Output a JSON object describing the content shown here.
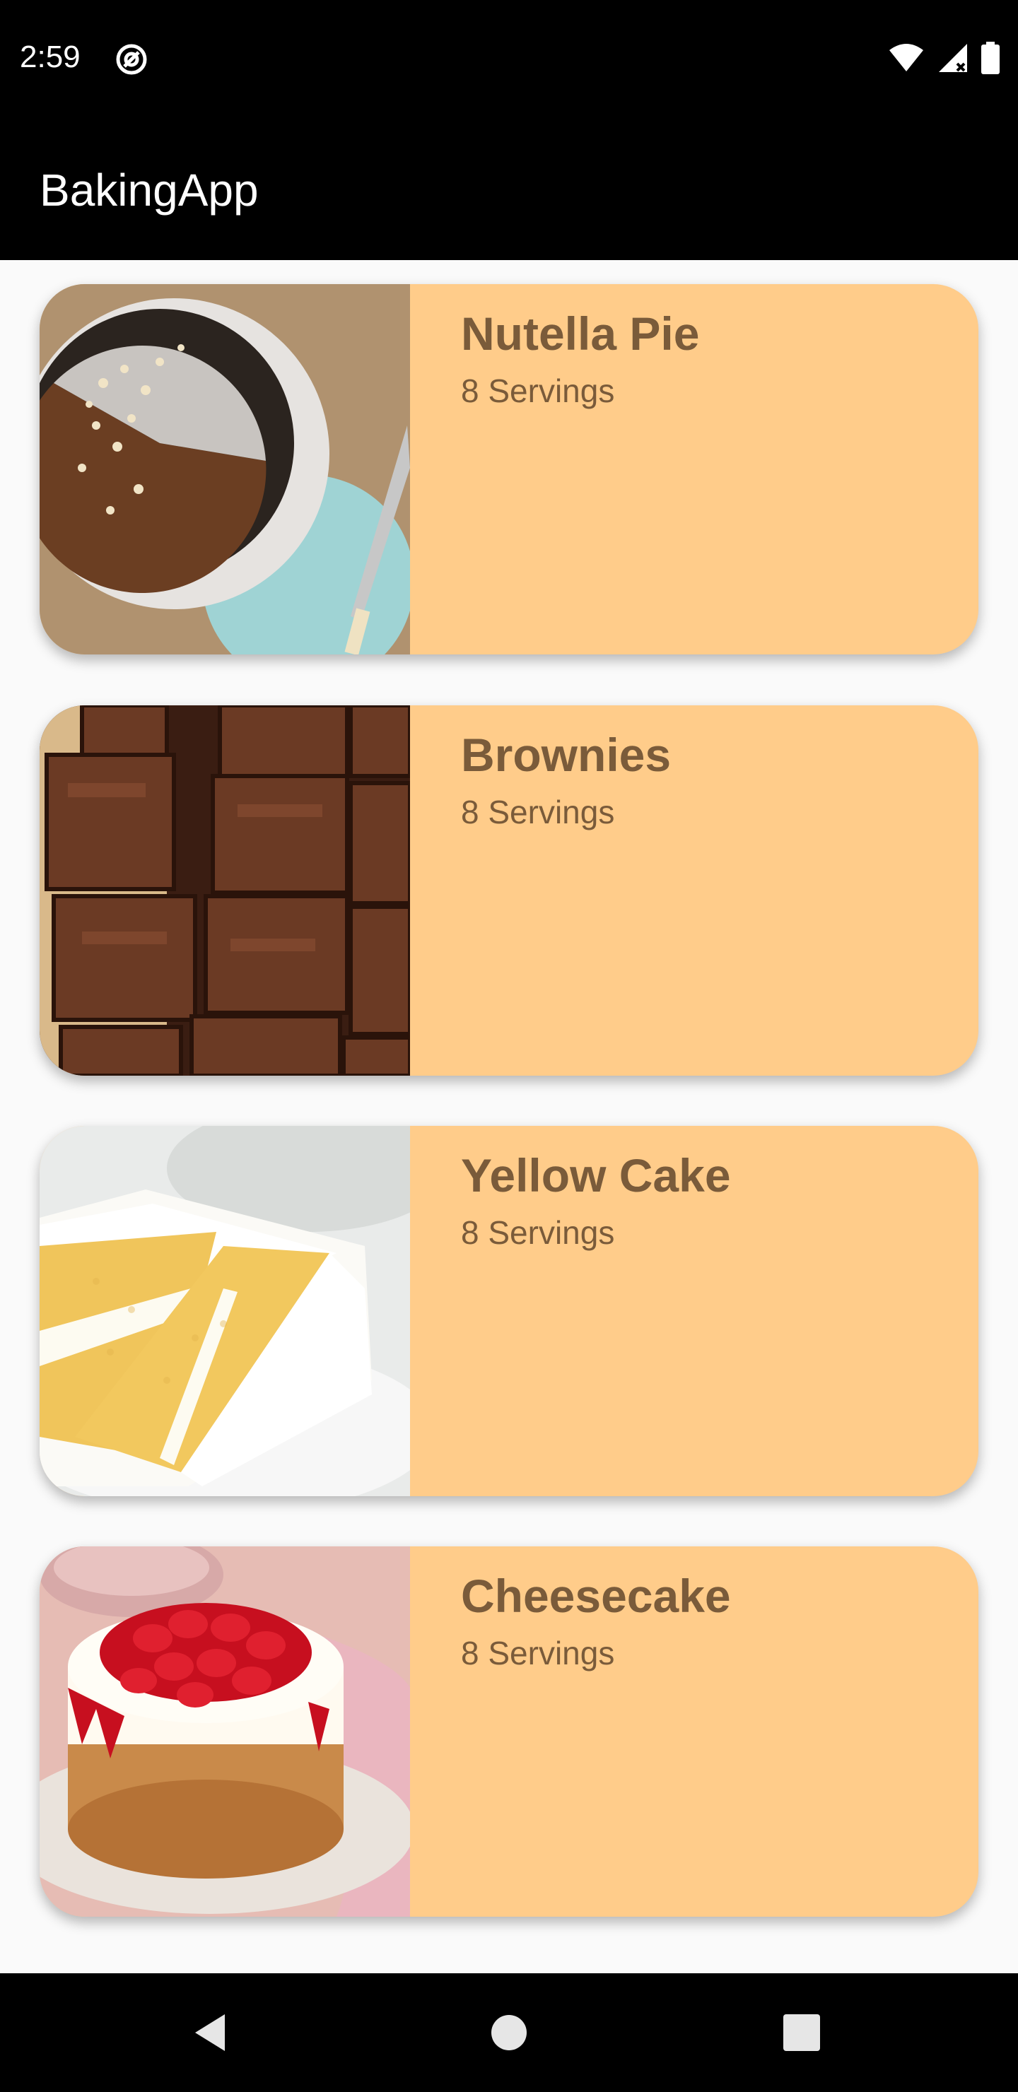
{
  "status_bar": {
    "time": "2:59",
    "icons": [
      "notification-at-icon",
      "wifi-icon",
      "signal-icon",
      "battery-icon"
    ]
  },
  "app_bar": {
    "title": "BakingApp"
  },
  "recipes": [
    {
      "name": "Nutella Pie",
      "servings": "8 Servings",
      "image": "nutella-pie-photo"
    },
    {
      "name": "Brownies",
      "servings": "8 Servings",
      "image": "brownies-photo"
    },
    {
      "name": "Yellow Cake",
      "servings": "8 Servings",
      "image": "yellow-cake-photo"
    },
    {
      "name": "Cheesecake",
      "servings": "8 Servings",
      "image": "cheesecake-photo"
    }
  ],
  "nav_bar": {
    "buttons": [
      "back-icon",
      "home-icon",
      "recents-icon"
    ]
  },
  "colors": {
    "card_background": "#ffcc8a",
    "card_text": "#7a5b3a",
    "bars": "#000000",
    "page_background": "#fafafa"
  }
}
